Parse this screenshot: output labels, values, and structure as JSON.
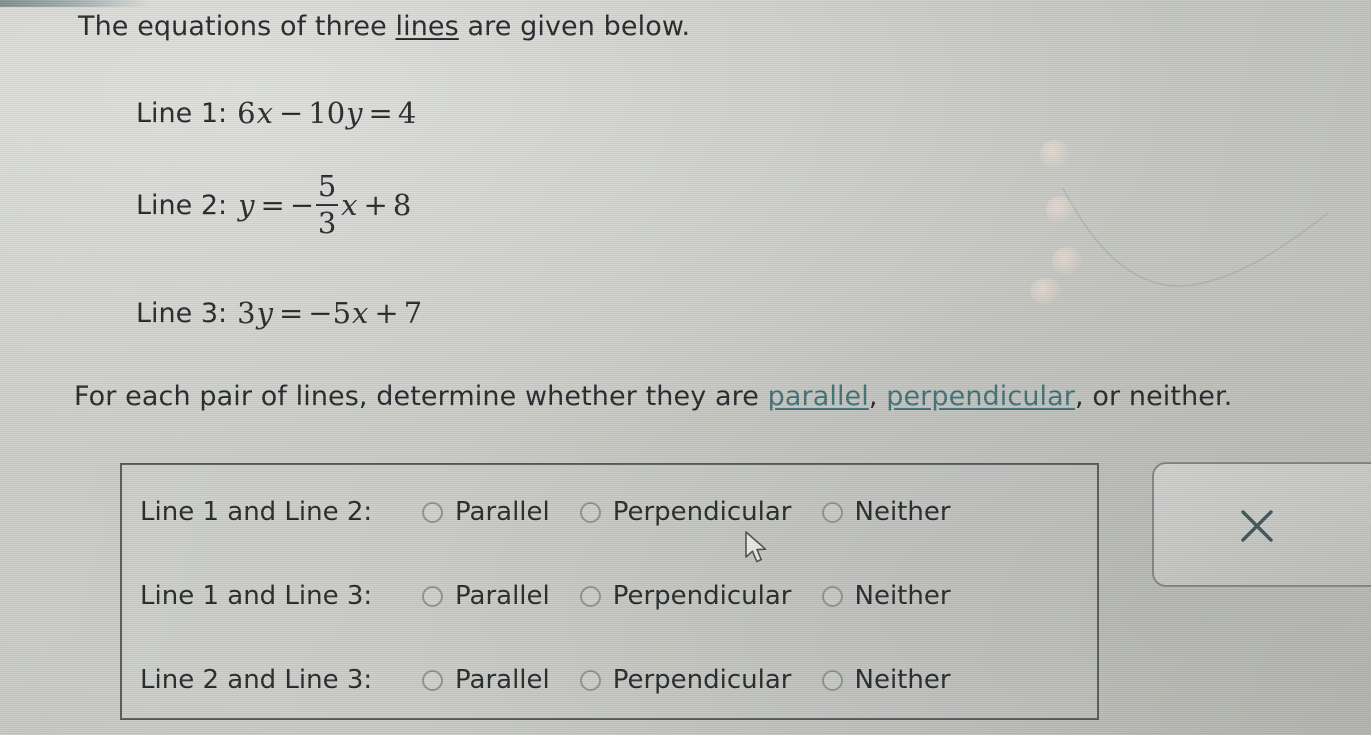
{
  "question": {
    "intro_before": "The equations of three ",
    "intro_link": "lines",
    "intro_after": " are given below.",
    "lines": [
      {
        "label": "Line 1:",
        "math_plain": "6x - 10y = 4",
        "parts": {
          "a": "6",
          "x": "x",
          "minus": "−",
          "b": "10",
          "y": "y",
          "eq": "=",
          "c": "4"
        }
      },
      {
        "label": "Line 2:",
        "math_plain": "y = -5/3 x + 8",
        "parts": {
          "y": "y",
          "eq": "=",
          "minus": "−",
          "num": "5",
          "den": "3",
          "x": "x",
          "plus": "+",
          "c": "8"
        }
      },
      {
        "label": "Line 3:",
        "math_plain": "3y = -5x + 7",
        "parts": {
          "a": "3",
          "y": "y",
          "eq": "=",
          "minus": "−",
          "b": "5",
          "x": "x",
          "plus": "+",
          "c": "7"
        }
      }
    ],
    "instruction_1": "For each pair of lines, determine whether they are ",
    "instruction_term_1": "parallel",
    "instruction_2": ", ",
    "instruction_term_2": "perpendicular",
    "instruction_3": ", or neither."
  },
  "answer_box": {
    "rows": [
      {
        "label": "Line 1 and Line 2:",
        "options": [
          "Parallel",
          "Perpendicular",
          "Neither"
        ],
        "selected": null
      },
      {
        "label": "Line 1 and Line 3:",
        "options": [
          "Parallel",
          "Perpendicular",
          "Neither"
        ],
        "selected": null
      },
      {
        "label": "Line 2 and Line 3:",
        "options": [
          "Parallel",
          "Perpendicular",
          "Neither"
        ],
        "selected": null
      }
    ]
  },
  "close_panel": {
    "icon": "close-icon",
    "label": "×"
  },
  "colors": {
    "page_background": "#c8c9c4",
    "text": "#24282a",
    "link_term": "#3f6f74",
    "box_border": "#55595a",
    "radio_border": "#8d9193",
    "close_icon": "#3d5257"
  }
}
